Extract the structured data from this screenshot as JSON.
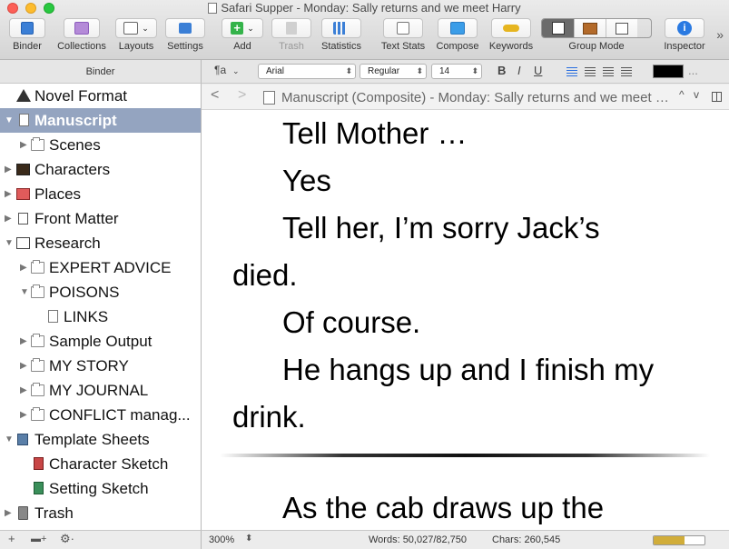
{
  "window": {
    "title": "Safari Supper - Monday: Sally returns and we meet Harry"
  },
  "toolbar": {
    "binder": "Binder",
    "collections": "Collections",
    "layouts": "Layouts",
    "settings": "Settings",
    "add": "Add",
    "trash": "Trash",
    "statistics": "Statistics",
    "text_stats": "Text Stats",
    "compose": "Compose",
    "keywords": "Keywords",
    "group_mode": "Group Mode",
    "inspector": "Inspector",
    "more": "»"
  },
  "sidebar": {
    "header": "Binder",
    "items": [
      {
        "label": "Novel Format",
        "icon": "warning-icon"
      },
      {
        "label": "Manuscript",
        "icon": "manuscript-icon"
      },
      {
        "label": "Scenes",
        "icon": "folder-icon"
      },
      {
        "label": "Characters",
        "icon": "characters-icon"
      },
      {
        "label": "Places",
        "icon": "places-icon"
      },
      {
        "label": "Front Matter",
        "icon": "front-matter-icon"
      },
      {
        "label": "Research",
        "icon": "research-icon"
      },
      {
        "label": "EXPERT ADVICE",
        "icon": "folder-icon"
      },
      {
        "label": "POISONS",
        "icon": "folder-icon"
      },
      {
        "label": "LINKS",
        "icon": "document-icon"
      },
      {
        "label": "Sample Output",
        "icon": "folder-icon"
      },
      {
        "label": "MY STORY",
        "icon": "folder-icon"
      },
      {
        "label": "MY JOURNAL",
        "icon": "folder-icon"
      },
      {
        "label": "CONFLICT manag...",
        "icon": "folder-icon"
      },
      {
        "label": "Template Sheets",
        "icon": "template-icon"
      },
      {
        "label": "Character Sketch",
        "icon": "character-sketch-icon"
      },
      {
        "label": "Setting Sketch",
        "icon": "setting-sketch-icon"
      },
      {
        "label": "Trash",
        "icon": "trash-icon"
      }
    ],
    "footer": {
      "add": "+",
      "add_folder": "▬+",
      "gear": "⚙︎·"
    }
  },
  "format_bar": {
    "paragraph_style": "¶a",
    "font": "Arial",
    "weight": "Regular",
    "size": "14",
    "bold": "B",
    "italic": "I",
    "underline": "U",
    "text_color": "#000000",
    "more": "..."
  },
  "header": {
    "back": "<",
    "forward": ">",
    "title": "Manuscript (Composite) - Monday: Sally returns and we meet Harry",
    "up": "^",
    "down": "v"
  },
  "editor": {
    "paragraphs": [
      "Tell Mother …",
      "Yes",
      "Tell her, I’m sorry Jack’s",
      "died.",
      "Of course.",
      "He hangs up and I finish my",
      "drink.",
      "As the cab draws up the"
    ]
  },
  "footer": {
    "zoom": "300%",
    "zoom_chevron": "⬍",
    "words": "Words: 50,027/82,750",
    "chars": "Chars: 260,545",
    "progress": 0.6
  }
}
